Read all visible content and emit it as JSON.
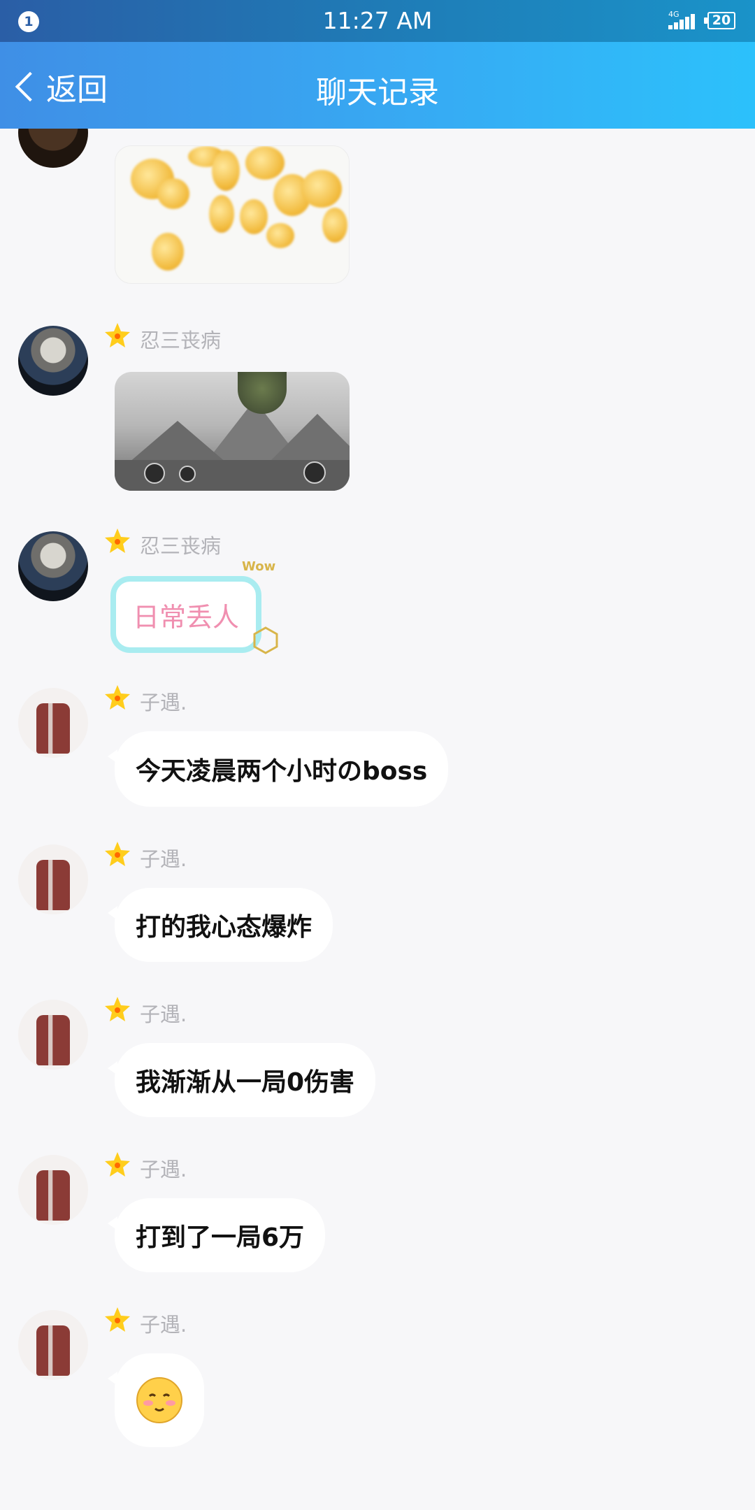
{
  "status_bar": {
    "notification_count": "1",
    "time": "11:27 AM",
    "network": "4G",
    "battery": "20"
  },
  "header": {
    "back_label": "返回",
    "title": "聊天记录"
  },
  "messages": [
    {
      "sender": "",
      "type": "image",
      "content": "coins-sticker"
    },
    {
      "sender": "忍三丧病",
      "type": "image",
      "content": "game-screenshot"
    },
    {
      "sender": "忍三丧病",
      "type": "sticker",
      "content": "日常丢人",
      "decoration": "Wow"
    },
    {
      "sender": "子遇.",
      "type": "text",
      "content": "今天凌晨两个小时のboss"
    },
    {
      "sender": "子遇.",
      "type": "text",
      "content": "打的我心态爆炸"
    },
    {
      "sender": "子遇.",
      "type": "text",
      "content": "我渐渐从一局0伤害"
    },
    {
      "sender": "子遇.",
      "type": "text",
      "content": "打到了一局6万"
    },
    {
      "sender": "子遇.",
      "type": "emoji",
      "content": "blush-emoji"
    }
  ],
  "colors": {
    "header_gradient_start": "#3f8fe6",
    "header_gradient_end": "#2cc1fb",
    "background": "#f7f7f9",
    "sender_name": "#b3b3b8",
    "sticker_text": "#f08fb0"
  }
}
